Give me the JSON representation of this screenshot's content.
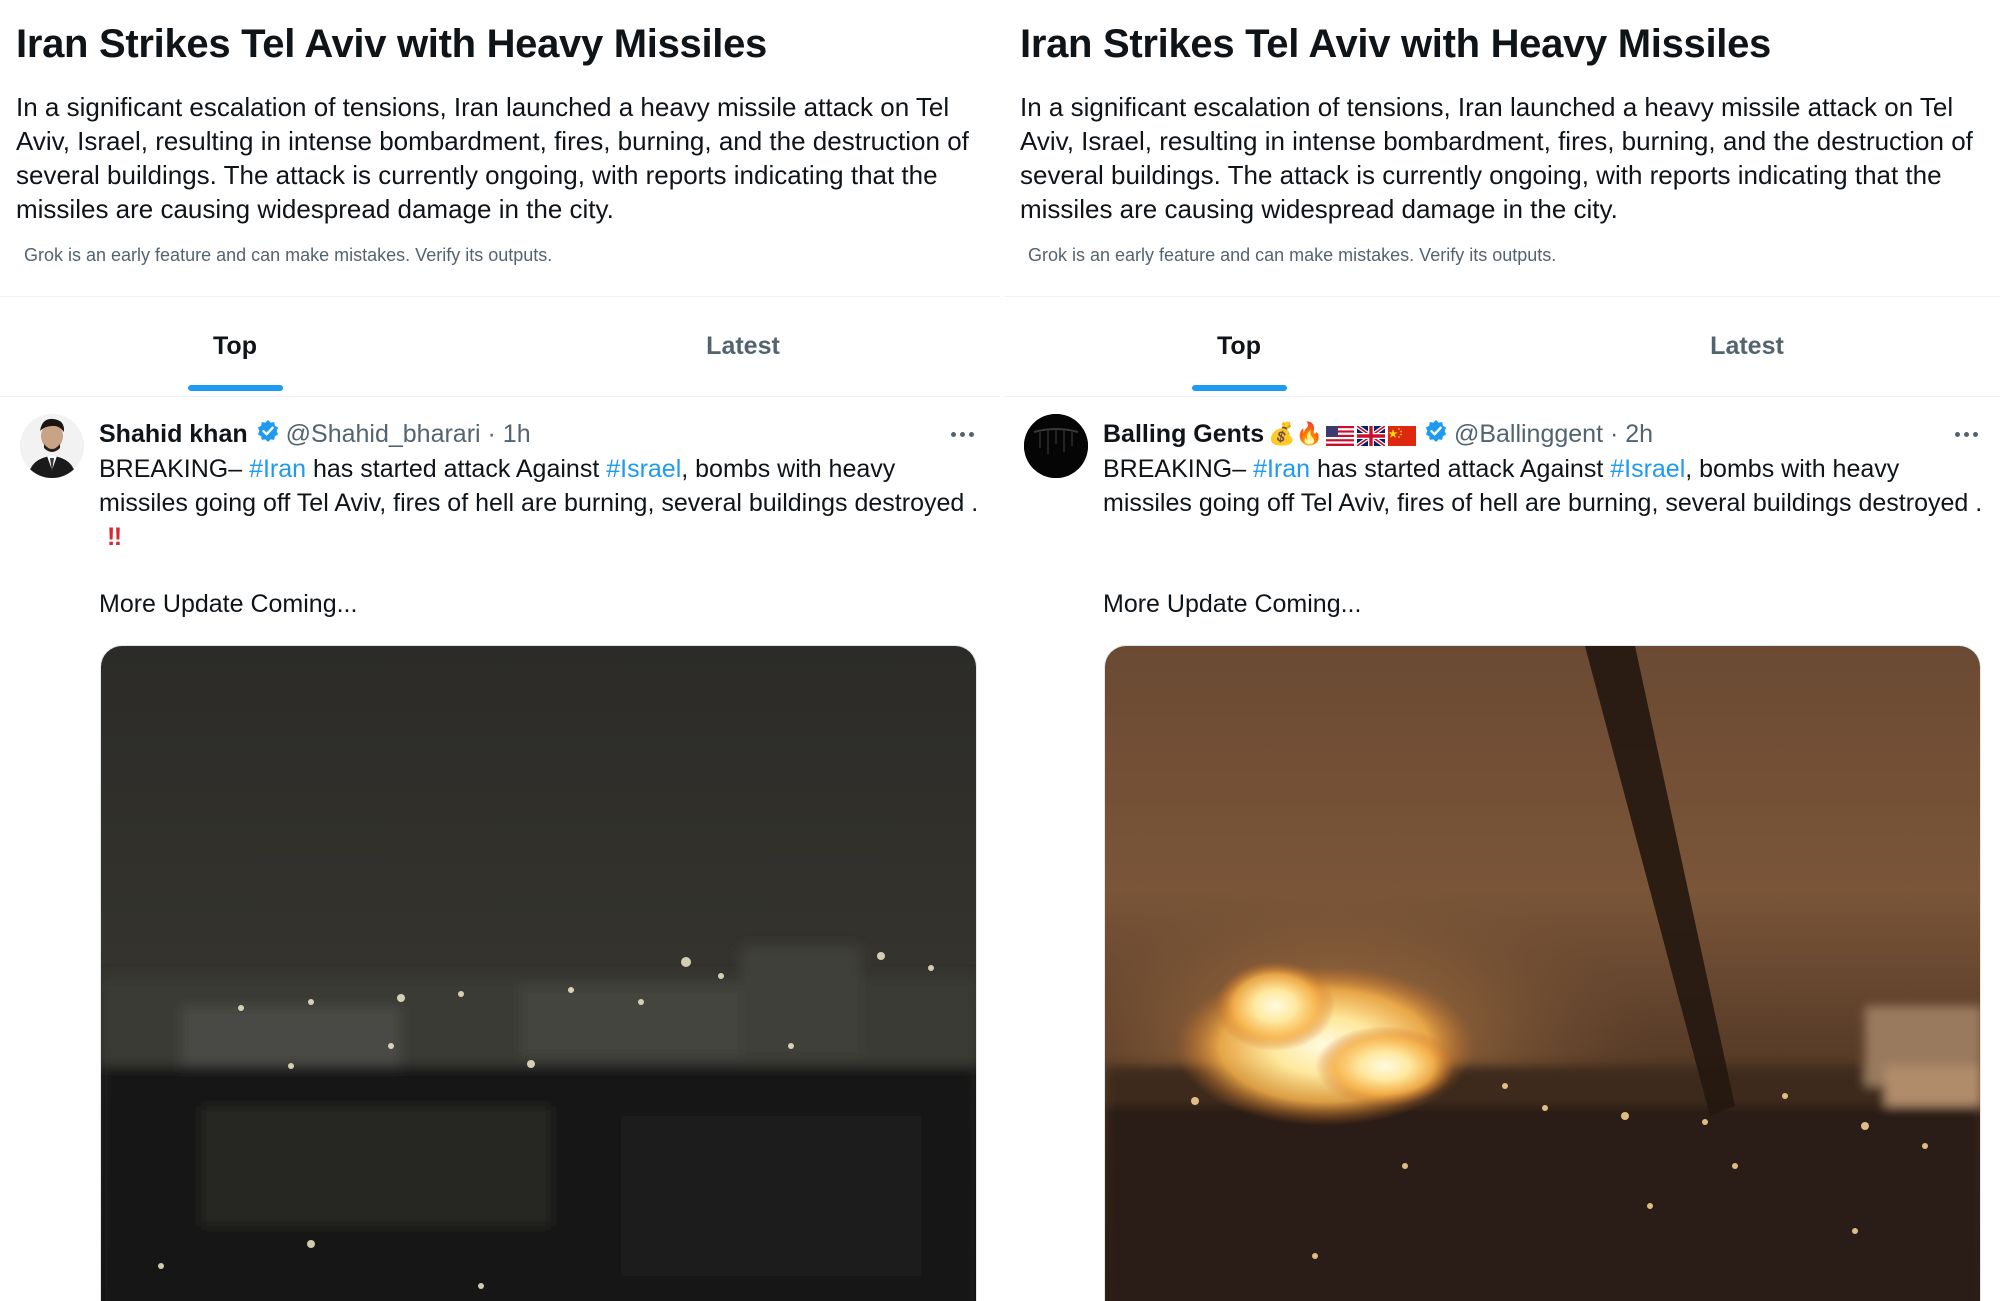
{
  "panels": [
    {
      "headline": "Iran Strikes Tel Aviv with Heavy Missiles",
      "summary": "In a significant escalation of tensions, Iran launched a heavy missile attack on Tel Aviv, Israel, resulting in intense bombardment, fires, burning, and the destruction of several buildings. The attack is currently ongoing, with reports indicating that the missiles are causing widespread damage in the city.",
      "disclaimer": "Grok is an early feature and can make mistakes. Verify its outputs.",
      "tabs": {
        "top": "Top",
        "latest": "Latest"
      },
      "post": {
        "author": "Shahid khan",
        "handle": "@Shahid_bharari · 1h",
        "text_before": "BREAKING– ",
        "tag1": "#Iran",
        "text_mid": " has started attack Against ",
        "tag2": "#Israel",
        "text_after": ", bombs with heavy missiles going off Tel Aviv, fires of hell are burning, several buildings destroyed . ",
        "bang": "‼",
        "update": "More Update Coming..."
      }
    },
    {
      "headline": "Iran Strikes Tel Aviv with Heavy Missiles",
      "summary": "In a significant escalation of tensions, Iran launched a heavy missile attack on Tel Aviv, Israel, resulting in intense bombardment, fires, burning, and the destruction of several buildings. The attack is currently ongoing, with reports indicating that the missiles are causing widespread damage in the city.",
      "disclaimer": "Grok is an early feature and can make mistakes. Verify its outputs.",
      "tabs": {
        "top": "Top",
        "latest": "Latest"
      },
      "post": {
        "author": "Balling Gents",
        "emojis": "💰🔥",
        "handle": "@Ballinggent · 2h",
        "text_before": "BREAKING– ",
        "tag1": "#Iran",
        "text_mid": " has started attack Against ",
        "tag2": "#Israel",
        "text_after": ", bombs with heavy missiles going off Tel Aviv, fires of hell are burning, several buildings destroyed .",
        "update": "More Update Coming..."
      }
    }
  ],
  "colors": {
    "accent": "#1d9bf0",
    "muted": "#536471",
    "text": "#0f1419"
  },
  "icons": [
    "verified-badge-icon",
    "more-options-icon",
    "money-bag-emoji",
    "fire-emoji",
    "us-flag-icon",
    "uk-flag-icon",
    "china-flag-icon"
  ]
}
